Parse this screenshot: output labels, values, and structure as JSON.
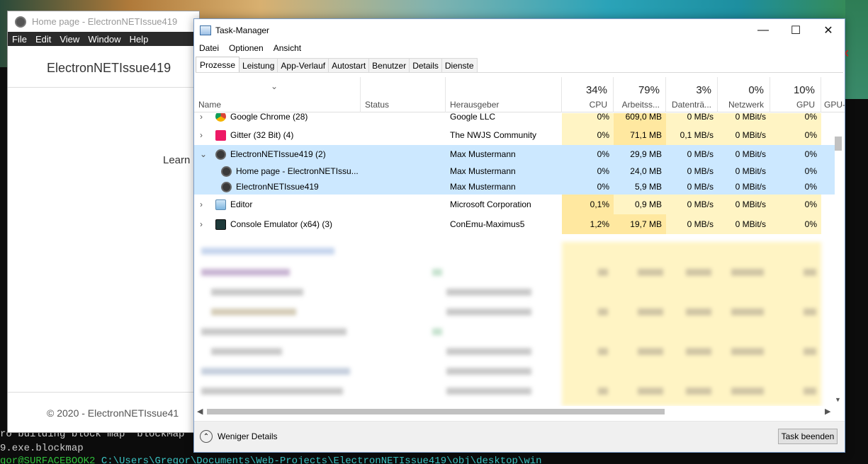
{
  "console": {
    "line1": "ro building block map  blockMap",
    "line2": "9.exe.blockmap",
    "line3_prompt": "gor@SURFACEBOOK2 ",
    "line3_path": "C:\\Users\\Gregor\\Documents\\Web-Projects\\ElectronNETIssue419\\obj\\desktop\\win"
  },
  "electron": {
    "title": "Home page - ElectronNETIssue419",
    "menu": [
      "File",
      "Edit",
      "View",
      "Window",
      "Help"
    ],
    "brand": "ElectronNETIssue419",
    "learn": "Learn",
    "footer": "© 2020 - ElectronNETIssue41"
  },
  "taskmanager": {
    "title": "Task-Manager",
    "controls": {
      "minimize": "—",
      "maximize": "☐",
      "close": "✕"
    },
    "menu": [
      "Datei",
      "Optionen",
      "Ansicht"
    ],
    "tabs": [
      "Prozesse",
      "Leistung",
      "App-Verlauf",
      "Autostart",
      "Benutzer",
      "Details",
      "Dienste"
    ],
    "active_tab": "Prozesse",
    "columns": {
      "name": "Name",
      "status": "Status",
      "publisher": "Herausgeber",
      "cpu": {
        "pct": "34%",
        "label": "CPU"
      },
      "mem": {
        "pct": "79%",
        "label": "Arbeitss..."
      },
      "disk": {
        "pct": "3%",
        "label": "Datenträ..."
      },
      "net": {
        "pct": "0%",
        "label": "Netzwerk"
      },
      "gpu": {
        "pct": "10%",
        "label": "GPU"
      },
      "gpu2": {
        "label": "GPU-"
      }
    },
    "rows": [
      {
        "name": "Google Chrome (28)",
        "publisher": "Google LLC",
        "cpu": "0%",
        "mem": "609,0 MB",
        "disk": "0 MB/s",
        "net": "0 MBit/s",
        "gpu": "0%"
      },
      {
        "name": "Gitter (32 Bit) (4)",
        "publisher": "The NWJS Community",
        "cpu": "0%",
        "mem": "71,1 MB",
        "disk": "0,1 MB/s",
        "net": "0 MBit/s",
        "gpu": "0%"
      },
      {
        "name": "ElectronNETIssue419 (2)",
        "publisher": "Max Mustermann",
        "cpu": "0%",
        "mem": "29,9 MB",
        "disk": "0 MB/s",
        "net": "0 MBit/s",
        "gpu": "0%"
      },
      {
        "name": "Home page - ElectronNETIssu...",
        "publisher": "Max Mustermann",
        "cpu": "0%",
        "mem": "24,0 MB",
        "disk": "0 MB/s",
        "net": "0 MBit/s",
        "gpu": "0%"
      },
      {
        "name": "ElectronNETIssue419",
        "publisher": "Max Mustermann",
        "cpu": "0%",
        "mem": "5,9 MB",
        "disk": "0 MB/s",
        "net": "0 MBit/s",
        "gpu": "0%"
      },
      {
        "name": "Editor",
        "publisher": "Microsoft Corporation",
        "cpu": "0,1%",
        "mem": "0,9 MB",
        "disk": "0 MB/s",
        "net": "0 MBit/s",
        "gpu": "0%"
      },
      {
        "name": "Console Emulator (x64) (3)",
        "publisher": "ConEmu-Maximus5",
        "cpu": "1,2%",
        "mem": "19,7 MB",
        "disk": "0 MB/s",
        "net": "0 MBit/s",
        "gpu": "0%"
      }
    ],
    "footer": {
      "fewer_details": "Weniger Details",
      "end_task": "Task beenden"
    }
  }
}
